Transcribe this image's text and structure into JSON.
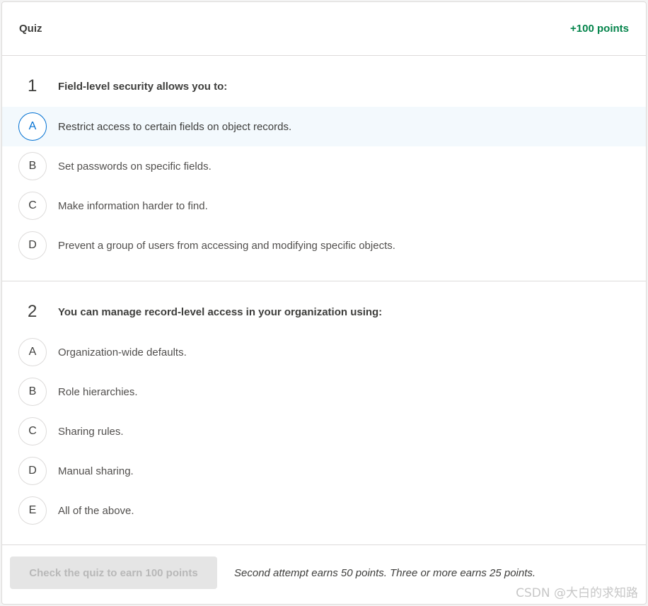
{
  "header": {
    "title": "Quiz",
    "points": "+100 points"
  },
  "questions": [
    {
      "number": "1",
      "text": "Field-level security allows you to:",
      "options": [
        {
          "letter": "A",
          "text": "Restrict access to certain fields on object records.",
          "selected": true
        },
        {
          "letter": "B",
          "text": "Set passwords on specific fields."
        },
        {
          "letter": "C",
          "text": "Make information harder to find."
        },
        {
          "letter": "D",
          "text": "Prevent a group of users from accessing and modifying specific objects."
        }
      ]
    },
    {
      "number": "2",
      "text": "You can manage record-level access in your organization using:",
      "options": [
        {
          "letter": "A",
          "text": "Organization-wide defaults."
        },
        {
          "letter": "B",
          "text": "Role hierarchies."
        },
        {
          "letter": "C",
          "text": "Sharing rules."
        },
        {
          "letter": "D",
          "text": "Manual sharing."
        },
        {
          "letter": "E",
          "text": "All of the above."
        }
      ]
    }
  ],
  "footer": {
    "check_button": "Check the quiz to earn 100 points",
    "note": "Second attempt earns 50 points. Three or more earns 25 points."
  },
  "watermark": "CSDN @大白的求知路",
  "colors": {
    "accent": "#0070d2",
    "points_green": "#04844b",
    "selected_bg": "#f3f9fd"
  }
}
